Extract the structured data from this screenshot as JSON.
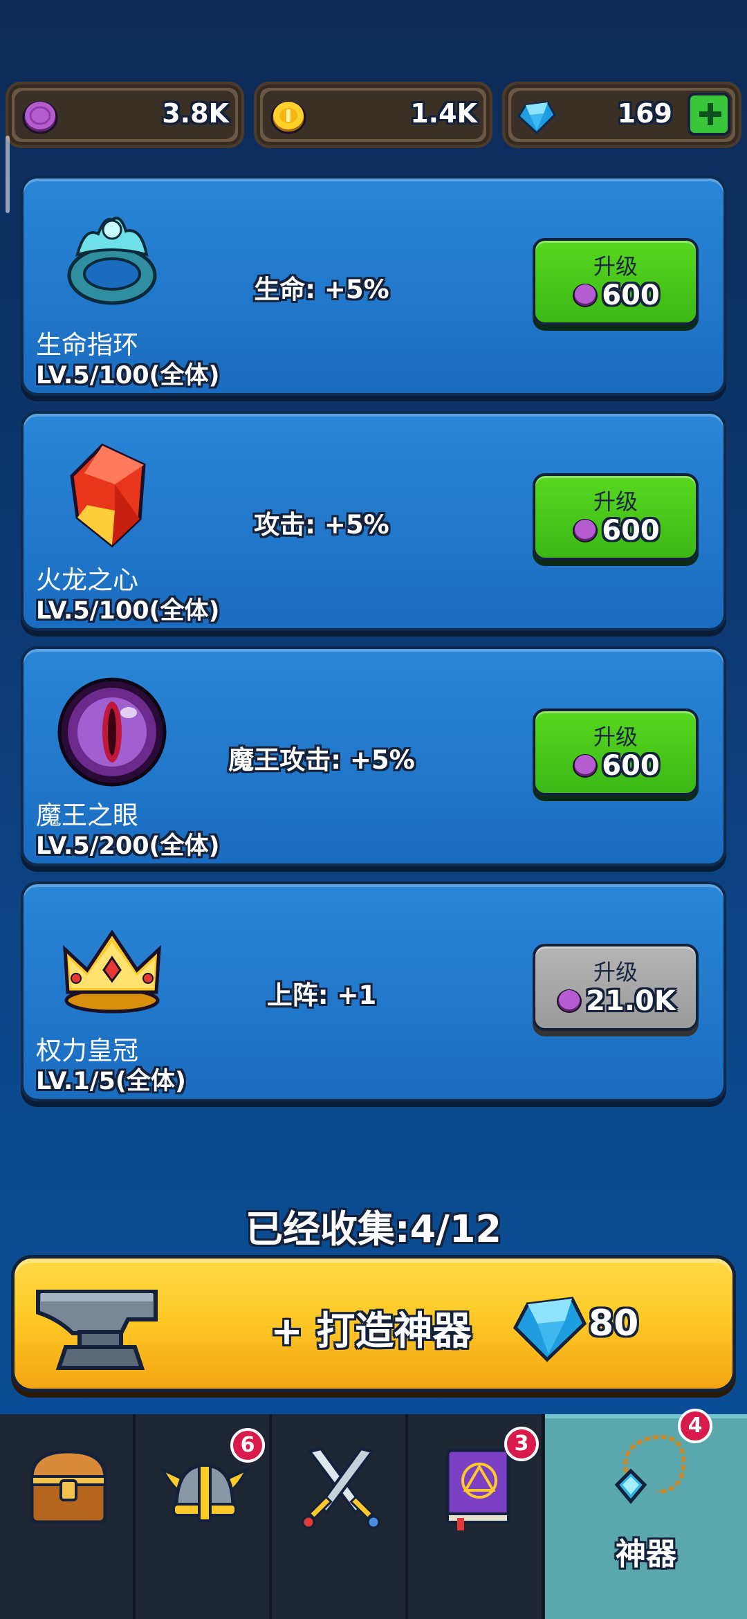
{
  "currencies": [
    {
      "icon": "purple-coin-icon",
      "value": "3.8K"
    },
    {
      "icon": "gold-coin-icon",
      "value": "1.4K"
    },
    {
      "icon": "diamond-icon",
      "value": "169"
    }
  ],
  "artifacts": [
    {
      "icon": "ring-icon",
      "name": "生命指环",
      "level": "LV.5/100(全体)",
      "effect": "生命: +5%",
      "upgrade_label": "升级",
      "cost": "600",
      "enabled": true
    },
    {
      "icon": "fire-crystal-icon",
      "name": "火龙之心",
      "level": "LV.5/100(全体)",
      "effect": "攻击: +5%",
      "upgrade_label": "升级",
      "cost": "600",
      "enabled": true
    },
    {
      "icon": "demon-eye-icon",
      "name": "魔王之眼",
      "level": "LV.5/200(全体)",
      "effect": "魔王攻击: +5%",
      "upgrade_label": "升级",
      "cost": "600",
      "enabled": true
    },
    {
      "icon": "crown-icon",
      "name": "权力皇冠",
      "level": "LV.1/5(全体)",
      "effect": "上阵: +1",
      "upgrade_label": "升级",
      "cost": "21.0K",
      "enabled": false
    }
  ],
  "collected": "已经收集:4/12",
  "forge": {
    "label": "+ 打造神器",
    "cost": "80"
  },
  "tabs": [
    {
      "icon": "treasure-chest-icon",
      "badge": ""
    },
    {
      "icon": "viking-helmet-icon",
      "badge": "6"
    },
    {
      "icon": "crossed-swords-icon",
      "badge": ""
    },
    {
      "icon": "spellbook-icon",
      "badge": "3"
    },
    {
      "icon": "amulet-icon",
      "badge": "4",
      "label": "神器"
    }
  ],
  "colors": {
    "upgrade_green": "#4ccb1c",
    "disabled_gray": "#a8a8a8",
    "forge_yellow": "#ffca28",
    "active_tab": "#5aa7ae"
  }
}
